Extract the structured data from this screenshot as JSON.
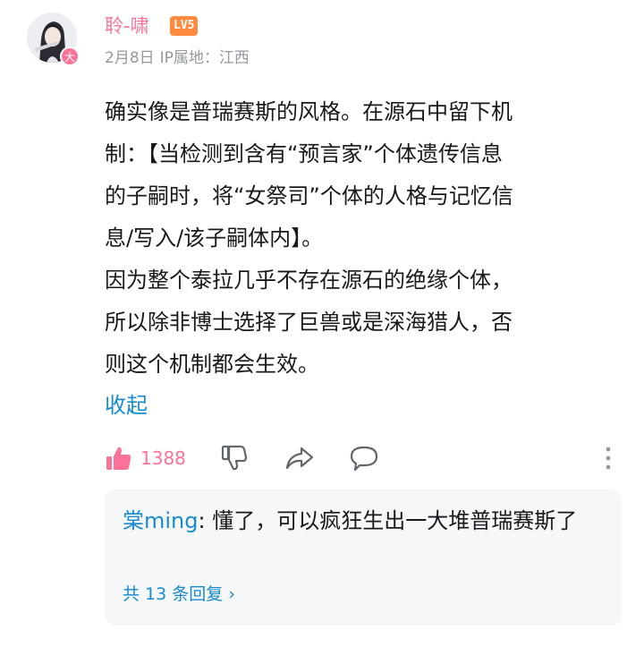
{
  "comment": {
    "avatar_icon": "anime-character-avatar",
    "avatar_badge": "大",
    "username": "聆-啸",
    "level": "LV5",
    "date": "2月8日",
    "ip_location": "IP属地：江西",
    "content": "确实像是普瑞赛斯的风格。在源石中留下机\n制：【当检测到含有“预言家”个体遗传信息\n的子嗣时，将“女祭司”个体的人格与记忆信\n息/写入/该子嗣体内】。\n因为整个泰拉几乎不存在源石的绝缘个体，\n所以除非博士选择了巨兽或是深海猎人，否\n则这个机制都会生效。",
    "collapse_label": "收起",
    "like_count": "1388",
    "accent_color": "#fb7299",
    "link_color": "#178bcf"
  },
  "actions": {
    "like_icon": "thumb-up-icon",
    "dislike_icon": "thumb-down-icon",
    "share_icon": "share-icon",
    "reply_icon": "comment-icon",
    "more_icon": "more-vertical-icon"
  },
  "reply_preview": {
    "user": "棠ming",
    "separator": ": ",
    "text": "懂了，可以疯狂生出一大堆普瑞赛斯了",
    "more_label": "共 13 条回复",
    "more_chevron": "›"
  }
}
